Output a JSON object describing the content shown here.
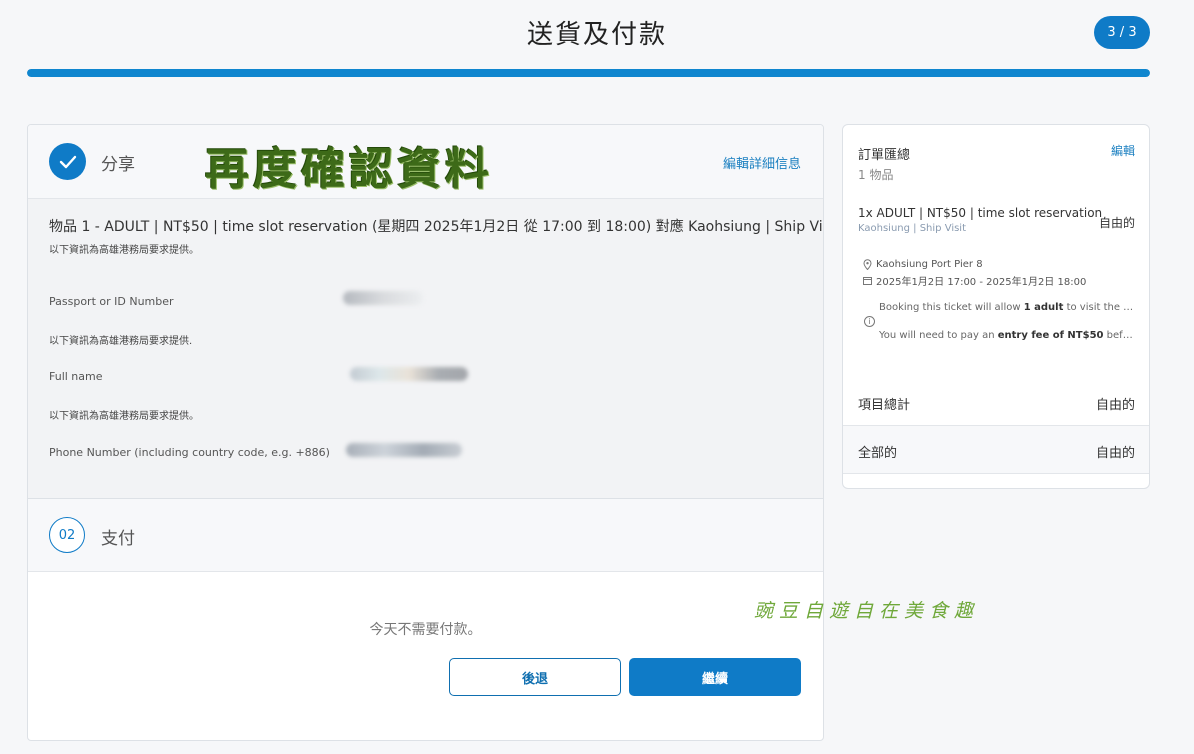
{
  "header": {
    "title": "送貨及付款",
    "step": "3 / 3",
    "progress_fraction": 1.0
  },
  "share_section": {
    "title": "分享",
    "overlay_text": "再度確認資料",
    "edit_label": "編輯詳細信息",
    "item_line": "物品 1 - ADULT | NT$50 | time slot reservation (星期四 2025年1月2日 從 17:00 到 18:00) 對應 Kaohsiung | Ship Visit",
    "fields": [
      {
        "note": "以下資訊為高雄港務局要求提供。",
        "label": "Passport or ID Number"
      },
      {
        "note": "以下資訊為高雄港務局要求提供.",
        "label": "Full name"
      },
      {
        "note": "以下資訊為高雄港務局要求提供。",
        "label": "Phone Number (including country code, e.g. +886)"
      }
    ]
  },
  "payment_section": {
    "number": "02",
    "title": "支付",
    "no_payment_text": "今天不需要付款。",
    "back_label": "後退",
    "continue_label": "繼續"
  },
  "summary": {
    "title": "訂單匯總",
    "edit_label": "編輯",
    "count": "1 物品",
    "item_name": "1x ADULT | NT$50 | time slot reservation",
    "item_sub": "Kaohsiung | Ship Visit",
    "item_price": "自由的",
    "location": "Kaohsiung Port Pier 8",
    "datetime": "2025年1月2日 17:00 - 2025年1月2日 18:00",
    "note1_pre": "Booking this ticket will allow ",
    "note1_bold": "1 adult",
    "note1_post": " to visit the ship i...",
    "note2_pre": "You will need to pay an ",
    "note2_bold": "entry fee of NT$50",
    "note2_post": " before bo...",
    "subtotal_label": "項目總計",
    "subtotal_value": "自由的",
    "total_label": "全部的",
    "total_value": "自由的"
  },
  "watermark": "豌豆自遊自在美食趣",
  "colors": {
    "accent": "#0f7bc7",
    "overlay_green": "#3d6a18",
    "watermark_green": "#6fa83a"
  }
}
